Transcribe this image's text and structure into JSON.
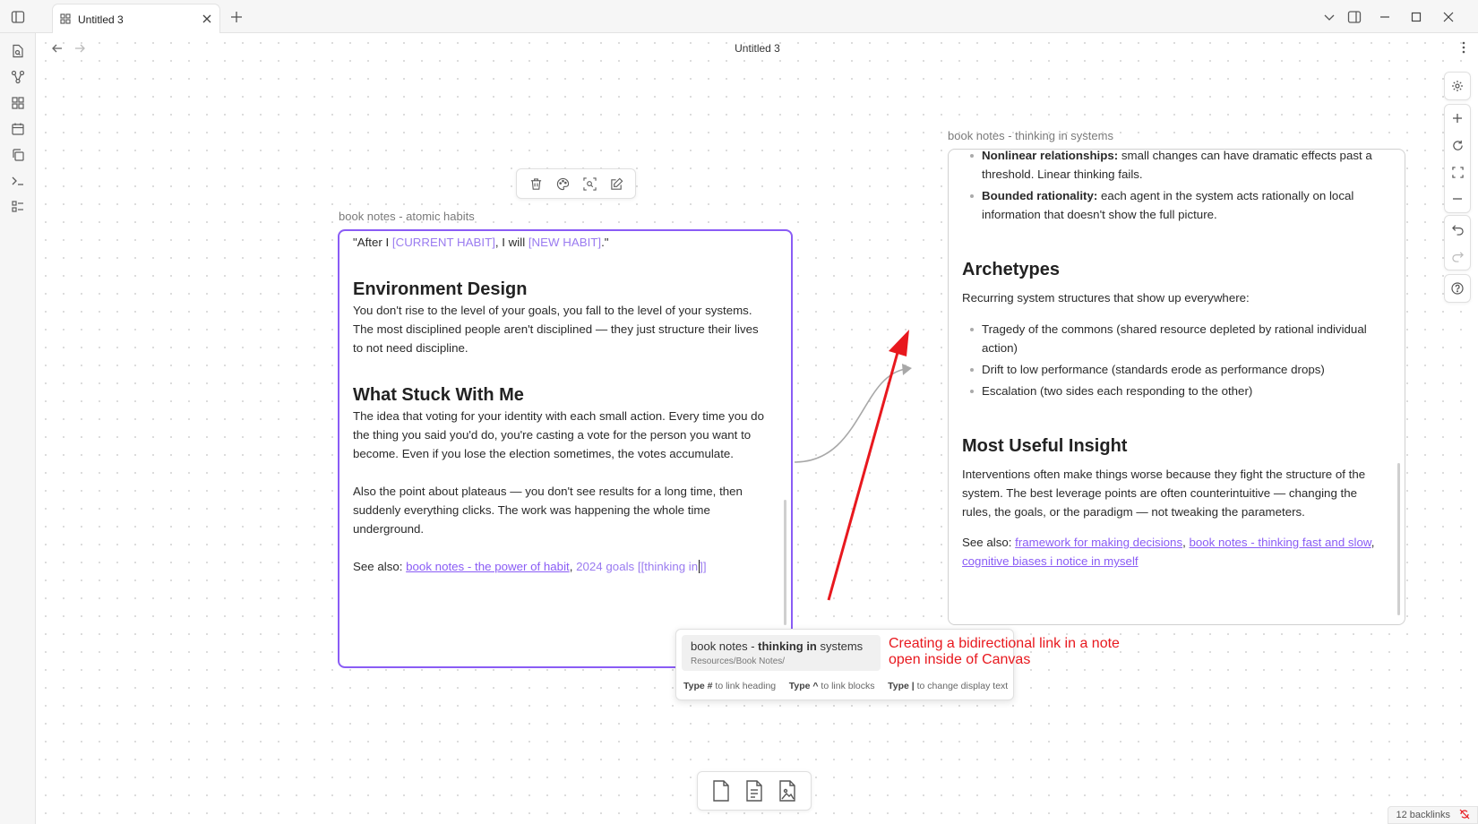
{
  "tab": {
    "title": "Untitled 3"
  },
  "view": {
    "title": "Untitled 3"
  },
  "left_note": {
    "label": "book notes - atomic habits",
    "quote_prefix": "\"After I ",
    "quote_current": "[CURRENT HABIT]",
    "quote_mid": ", I will ",
    "quote_new": "[NEW HABIT]",
    "quote_suffix": ".\"",
    "h_env": "Environment Design",
    "p_env": "You don't rise to the level of your goals, you fall to the level of your systems. The most disciplined people aren't disciplined — they just structure their lives to not need discipline.",
    "h_stuck": "What Stuck With Me",
    "p_stuck1": "The idea that voting for your identity with each small action. Every time you do the thing you said you'd do, you're casting a vote for the person you want to become. Even if you lose the election sometimes, the votes accumulate.",
    "p_stuck2": "Also the point about plateaus — you don't see results for a long time, then suddenly everything clicks. The work was happening the whole time underground.",
    "see_also_label": "See also: ",
    "see_also_link": "book notes - the power of habit",
    "see_also_sep": ", ",
    "see_also_goals": "2024 goals",
    "see_also_typing": " [[thinking in",
    "see_also_close": "]]"
  },
  "right_note": {
    "label": "book notes - thinking in systems",
    "b1_bold": "Nonlinear relationships:",
    "b1_text": " small changes can have dramatic effects past a threshold. Linear thinking fails.",
    "b2_bold": "Bounded rationality:",
    "b2_text": " each agent in the system acts rationally on local information that doesn't show the full picture.",
    "h_arch": "Archetypes",
    "p_arch": "Recurring system structures that show up everywhere:",
    "arch_items": [
      "Tragedy of the commons (shared resource depleted by rational individual action)",
      "Drift to low performance (standards erode as performance drops)",
      "Escalation (two sides each responding to the other)"
    ],
    "h_insight": "Most Useful Insight",
    "p_insight": "Interventions often make things worse because they fight the structure of the system. The best leverage points are often counterintuitive — changing the rules, the goals, or the paradigm — not tweaking the parameters.",
    "see_also_label": "See also: ",
    "link1": "framework for making decisions",
    "sep": ", ",
    "link2": "book notes - thinking fast and slow",
    "link3": "cognitive biases i notice in myself"
  },
  "suggestion": {
    "title_pre": "book notes - ",
    "title_bold": "thinking in",
    "title_post": " systems",
    "path": "Resources/Book Notes/",
    "hint1_key": "Type #",
    "hint1_text": " to link heading",
    "hint2_key": "Type ^",
    "hint2_text": " to link blocks",
    "hint3_key": "Type |",
    "hint3_text": " to change display text"
  },
  "annotation": {
    "text": "Creating a bidirectional link in a note open inside of Canvas"
  },
  "status": {
    "backlinks": "12 backlinks"
  },
  "colors": {
    "accent": "#8a5cf5",
    "annotation": "#e8181e"
  }
}
